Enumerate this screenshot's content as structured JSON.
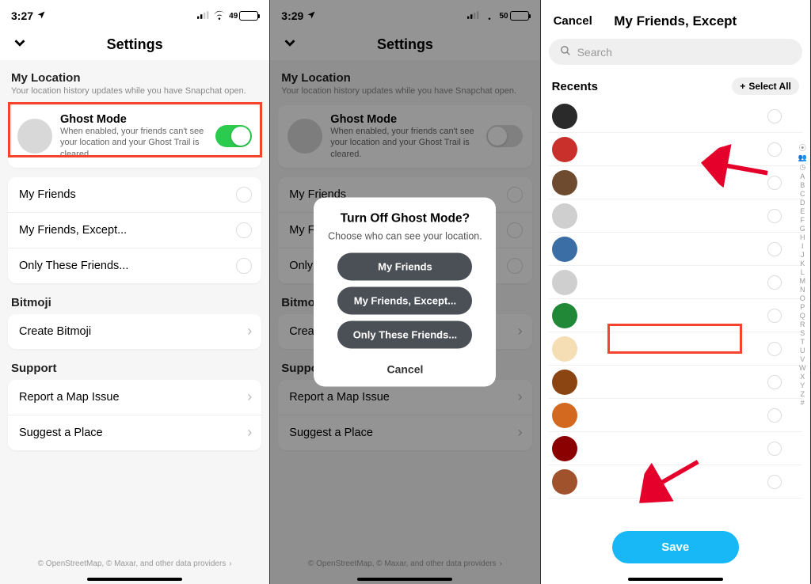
{
  "panel1": {
    "time": "3:27",
    "battery": "49",
    "header_title": "Settings",
    "location_section": "My Location",
    "location_sub": "Your location history updates while you have Snapchat open.",
    "ghost": {
      "title": "Ghost Mode",
      "desc": "When enabled, your friends can't see your location and your Ghost Trail is cleared."
    },
    "options": [
      "My Friends",
      "My Friends, Except...",
      "Only These Friends..."
    ],
    "bitmoji_section": "Bitmoji",
    "bitmoji_item": "Create Bitmoji",
    "support_section": "Support",
    "support_items": [
      "Report a Map Issue",
      "Suggest a Place"
    ],
    "footer": "© OpenStreetMap, © Maxar, and other data providers"
  },
  "panel2": {
    "time": "3:29",
    "battery": "50",
    "modal": {
      "title": "Turn Off Ghost Mode?",
      "subtitle": "Choose who can see your location.",
      "buttons": [
        "My Friends",
        "My Friends, Except...",
        "Only These Friends..."
      ],
      "cancel": "Cancel"
    }
  },
  "panel3": {
    "cancel": "Cancel",
    "title": "My Friends, Except",
    "search_placeholder": "Search",
    "recents": "Recents",
    "select_all": "Select All",
    "save": "Save",
    "index": [
      "A",
      "B",
      "C",
      "D",
      "E",
      "F",
      "G",
      "H",
      "I",
      "J",
      "K",
      "L",
      "M",
      "N",
      "O",
      "P",
      "Q",
      "R",
      "S",
      "T",
      "U",
      "V",
      "W",
      "X",
      "Y",
      "Z",
      "#"
    ]
  }
}
